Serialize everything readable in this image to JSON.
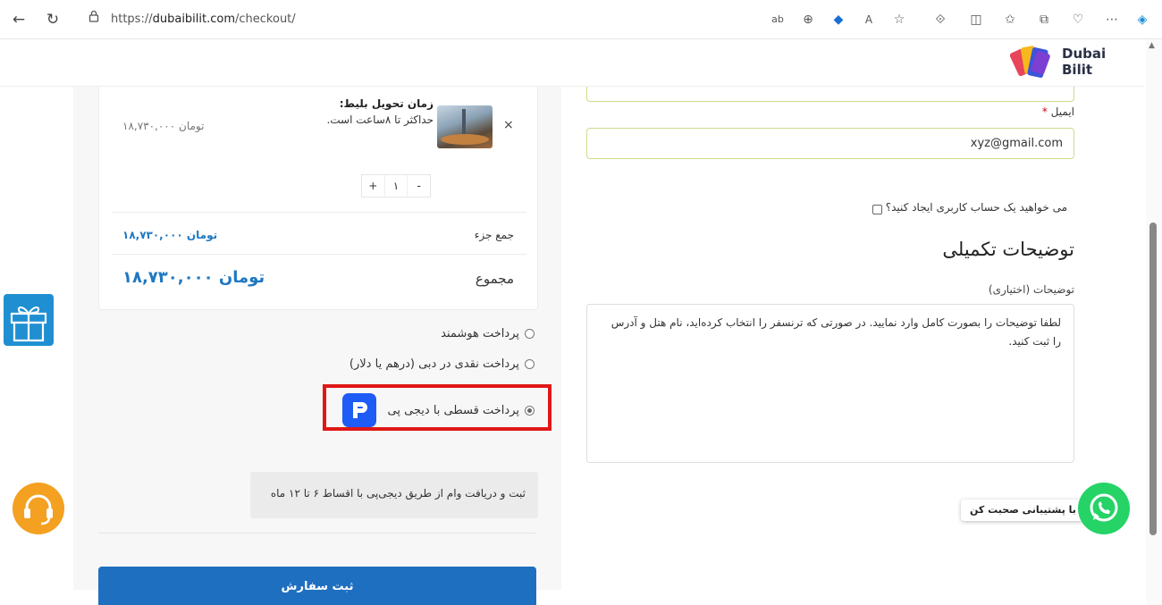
{
  "browser": {
    "url_prefix": "https://",
    "url_domain": "dubaibilit.com",
    "url_path": "/checkout/"
  },
  "brand": {
    "line1": "Dubai",
    "line2": "Bilit"
  },
  "cart": {
    "line_price": "۱۸,۷۳۰,۰۰۰ تومان",
    "product_title": "زمان تحویل بلیط:",
    "product_desc": "حداکثر تا ۸ساعت است.",
    "remove": "×",
    "qty_plus": "+",
    "qty_value": "۱",
    "qty_minus": "-",
    "subtotal_label": "جمع جزء",
    "subtotal_value": "۱۸,۷۳۰,۰۰۰ تومان",
    "total_label": "مجموع",
    "total_value": "۱۸,۷۳۰,۰۰۰ تومان"
  },
  "payment": {
    "options": [
      {
        "label": "پرداخت هوشمند",
        "selected": false
      },
      {
        "label": "پرداخت نقدی در دبی (درهم یا دلار)",
        "selected": false
      },
      {
        "label": "پرداخت قسطی با دیجی پی",
        "selected": true
      }
    ],
    "info": "ثبت و دریافت وام از طریق دیجی‌پی با اقساط ۶ تا ۱۲ ماه",
    "submit": "ثبت سفارش"
  },
  "form": {
    "email_label": "ایمیل",
    "email_required": "*",
    "email_value": "xyz@gmail.com",
    "create_account": "می خواهید یک حساب کاربری ایجاد کنید؟",
    "notes_title": "توضیحات تکمیلی",
    "notes_label": "توضیحات (اختیاری)",
    "notes_placeholder": "لطفا توضیحات را بصورت کامل وارد نمایید. در صورتی که ترنسفر را انتخاب کرده‌اید، نام هتل و آدرس را ثبت کنید."
  },
  "widgets": {
    "chat_label": "با پشتیبانی صحبت کن"
  },
  "colors": {
    "accent": "#1f78c1",
    "button": "#1f6fc0",
    "highlight": "#e01717",
    "digipay": "#1e5cf5",
    "whatsapp": "#25d366",
    "support": "#f4a020"
  }
}
